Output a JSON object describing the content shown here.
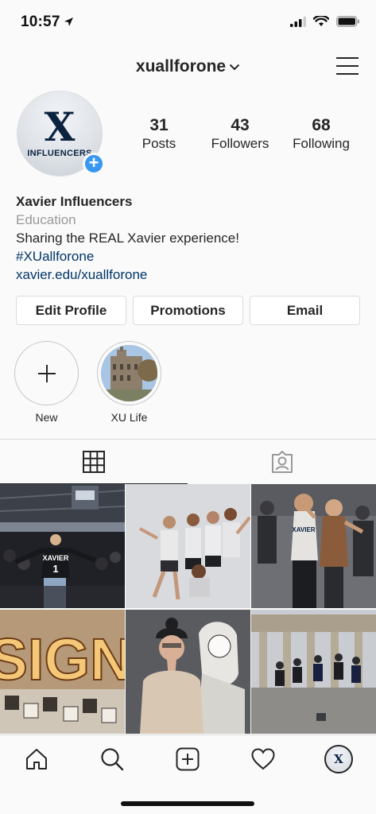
{
  "status_bar": {
    "time": "10:57",
    "icons": [
      "location-arrow-icon",
      "signal-icon",
      "wifi-icon",
      "battery-icon"
    ]
  },
  "header": {
    "username": "xuallforone",
    "icons": [
      "chevron-down-icon",
      "hamburger-menu-icon"
    ]
  },
  "profile": {
    "avatar_logo_letter": "X",
    "avatar_logo_text": "INFLUENCERS",
    "stats": [
      {
        "value": "31",
        "label": "Posts"
      },
      {
        "value": "43",
        "label": "Followers"
      },
      {
        "value": "68",
        "label": "Following"
      }
    ],
    "name": "Xavier Influencers",
    "category": "Education",
    "bio": "Sharing the REAL Xavier experience!",
    "hashtag": "#XUallforone",
    "link": "xavier.edu/xuallforone"
  },
  "buttons": {
    "edit_profile": "Edit Profile",
    "promotions": "Promotions",
    "email": "Email"
  },
  "highlights": [
    {
      "label": "New"
    },
    {
      "label": "XU Life"
    }
  ],
  "tabs": {
    "icons": [
      "grid-icon",
      "tagged-icon"
    ],
    "active": "grid"
  },
  "posts": {
    "sign_text": "SIGN",
    "xavier_shirt": "XAVIER"
  },
  "bottom_nav": {
    "items": [
      "home-icon",
      "search-icon",
      "new-post-icon",
      "activity-heart-icon",
      "profile-avatar-icon"
    ],
    "mini_avatar_letter": "X"
  },
  "colors": {
    "link": "#003569",
    "accent_blue": "#3897f0",
    "xavier_navy": "#0c2340"
  }
}
